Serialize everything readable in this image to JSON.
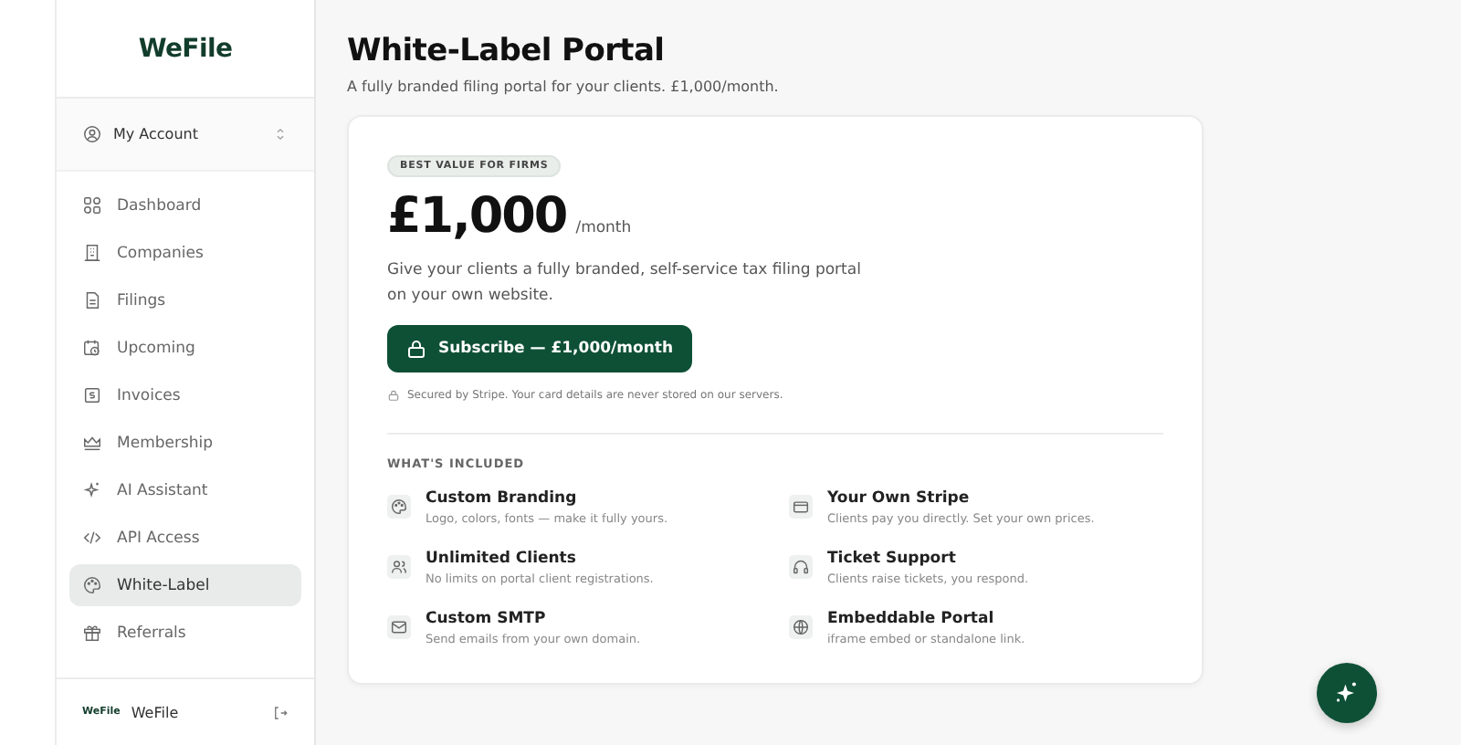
{
  "sidebar": {
    "logo": "WeFile",
    "account": {
      "label": "My Account"
    },
    "items": [
      {
        "label": "Dashboard",
        "selected": false
      },
      {
        "label": "Companies",
        "selected": false
      },
      {
        "label": "Filings",
        "selected": false
      },
      {
        "label": "Upcoming",
        "selected": false
      },
      {
        "label": "Invoices",
        "selected": false
      },
      {
        "label": "Membership",
        "selected": false
      },
      {
        "label": "AI Assistant",
        "selected": false
      },
      {
        "label": "API Access",
        "selected": false
      },
      {
        "label": "White-Label",
        "selected": true
      },
      {
        "label": "Referrals",
        "selected": false
      }
    ],
    "footer": {
      "logo": "WeFile",
      "name": "WeFile"
    }
  },
  "page": {
    "title": "White-Label Portal",
    "subtitle": "A fully branded filing portal for your clients. £1,000/month."
  },
  "card": {
    "badge": "BEST VALUE FOR FIRMS",
    "price": "£1,000",
    "period": "/month",
    "description": "Give your clients a fully branded, self-service tax filing portal on your own website.",
    "button": "Subscribe — £1,000/month",
    "secure_note": "Secured by Stripe. Your card details are never stored on our servers.",
    "included_heading": "WHAT'S INCLUDED",
    "features": [
      {
        "title": "Custom Branding",
        "text": "Logo, colors, fonts — make it fully yours."
      },
      {
        "title": "Your Own Stripe",
        "text": "Clients pay you directly. Set your own prices."
      },
      {
        "title": "Unlimited Clients",
        "text": "No limits on portal client registrations."
      },
      {
        "title": "Ticket Support",
        "text": "Clients raise tickets, you respond."
      },
      {
        "title": "Custom SMTP",
        "text": "Send emails from your own domain."
      },
      {
        "title": "Embeddable Portal",
        "text": "iframe embed or standalone link."
      }
    ]
  }
}
